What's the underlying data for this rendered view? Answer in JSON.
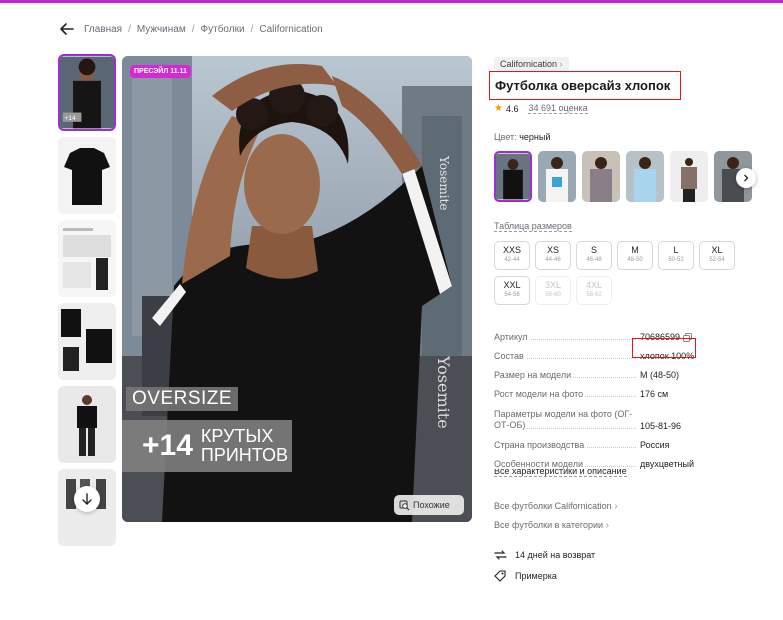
{
  "breadcrumbs": [
    "Главная",
    "Мужчинам",
    "Футболки",
    "Californication"
  ],
  "product": {
    "brand": "Californication",
    "title": "Футболка оверсайз хлопок",
    "rating": "4.6",
    "reviews": "34 691 оценка",
    "color_label": "Цвет:",
    "color_value": "черный"
  },
  "photo": {
    "badge": "ПРЕСЭЙЛ 11.11",
    "oversize": "OVERSIZE",
    "plus_num": "+14",
    "plus_line1": "КРУТЫХ",
    "plus_line2": "ПРИНТОВ",
    "similar": "Похожие",
    "thumb_badge": "+14"
  },
  "size_table": "Таблица размеров",
  "sizes": [
    {
      "name": "XXS",
      "range": "42-44",
      "available": true
    },
    {
      "name": "XS",
      "range": "44-46",
      "available": true
    },
    {
      "name": "S",
      "range": "46-48",
      "available": true
    },
    {
      "name": "M",
      "range": "48-50",
      "available": true
    },
    {
      "name": "L",
      "range": "50-52",
      "available": true
    },
    {
      "name": "XL",
      "range": "52-54",
      "available": true
    },
    {
      "name": "XXL",
      "range": "54-56",
      "available": true
    },
    {
      "name": "3XL",
      "range": "56-60",
      "available": false
    },
    {
      "name": "4XL",
      "range": "58-62",
      "available": false
    }
  ],
  "specs": [
    {
      "key": "Артикул",
      "value": "70686599"
    },
    {
      "key": "Состав",
      "value": "хлопок 100%"
    },
    {
      "key": "Размер на модели",
      "value": "M (48-50)"
    },
    {
      "key": "Рост модели на фото",
      "value": "176 см"
    },
    {
      "key": "Параметры модели на фото (ОГ-ОТ-ОБ)",
      "value": "105-81-96"
    },
    {
      "key": "Страна производства",
      "value": "Россия"
    },
    {
      "key": "Особенности модели",
      "value": "двухцветный"
    }
  ],
  "all_chars": "Все характеристики и описание",
  "links": [
    "Все футболки Californication",
    "Все футболки в категории"
  ],
  "features": [
    "14 дней на возврат",
    "Примерка"
  ],
  "colors": {
    "accent": "#9b2fd0",
    "highlight_box": "#ee1111",
    "badge": "#d629d6",
    "star": "#f4a100"
  }
}
